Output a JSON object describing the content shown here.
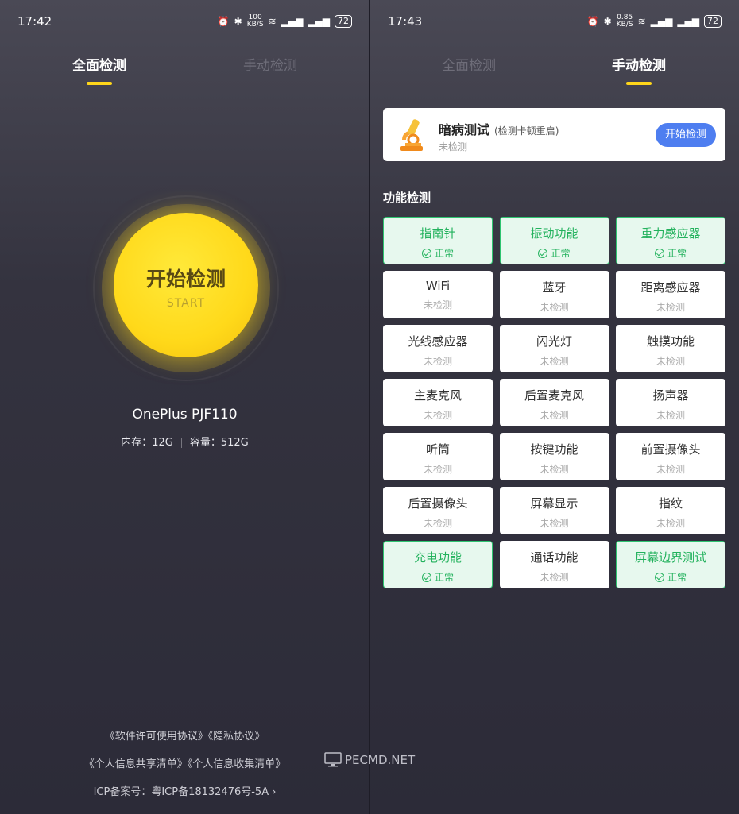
{
  "left": {
    "status": {
      "time": "17:42",
      "speed_top": "100",
      "speed_bottom": "KB/S",
      "battery": "72"
    },
    "tabs": [
      {
        "label": "全面检测",
        "active": true
      },
      {
        "label": "手动检测",
        "active": false
      }
    ],
    "start": {
      "label": "开始检测",
      "sub": "START"
    },
    "device": {
      "model": "OnePlus PJF110",
      "memory": "内存：12G",
      "storage": "容量：512G"
    },
    "footer": {
      "line1": "《软件许可使用协议》《隐私协议》",
      "line2": "《个人信息共享清单》《个人信息收集清单》",
      "icp": "ICP备案号：粤ICP备18132476号-5A",
      "icp_arrow": "›"
    }
  },
  "right": {
    "status": {
      "time": "17:43",
      "speed_top": "0.85",
      "speed_bottom": "KB/S",
      "battery": "72"
    },
    "tabs": [
      {
        "label": "全面检测",
        "active": false
      },
      {
        "label": "手动检测",
        "active": true
      }
    ],
    "card": {
      "title": "暗病测试",
      "subtitle": "(检测卡顿重启)",
      "state": "未检测",
      "button": "开始检测"
    },
    "section_title": "功能检测",
    "items": [
      {
        "name": "指南针",
        "status": "正常",
        "ok": true
      },
      {
        "name": "振动功能",
        "status": "正常",
        "ok": true
      },
      {
        "name": "重力感应器",
        "status": "正常",
        "ok": true
      },
      {
        "name": "WiFi",
        "status": "未检测",
        "ok": false
      },
      {
        "name": "蓝牙",
        "status": "未检测",
        "ok": false
      },
      {
        "name": "距离感应器",
        "status": "未检测",
        "ok": false
      },
      {
        "name": "光线感应器",
        "status": "未检测",
        "ok": false
      },
      {
        "name": "闪光灯",
        "status": "未检测",
        "ok": false
      },
      {
        "name": "触摸功能",
        "status": "未检测",
        "ok": false
      },
      {
        "name": "主麦克风",
        "status": "未检测",
        "ok": false
      },
      {
        "name": "后置麦克风",
        "status": "未检测",
        "ok": false
      },
      {
        "name": "扬声器",
        "status": "未检测",
        "ok": false
      },
      {
        "name": "听筒",
        "status": "未检测",
        "ok": false
      },
      {
        "name": "按键功能",
        "status": "未检测",
        "ok": false
      },
      {
        "name": "前置摄像头",
        "status": "未检测",
        "ok": false
      },
      {
        "name": "后置摄像头",
        "status": "未检测",
        "ok": false
      },
      {
        "name": "屏幕显示",
        "status": "未检测",
        "ok": false
      },
      {
        "name": "指纹",
        "status": "未检测",
        "ok": false
      },
      {
        "name": "充电功能",
        "status": "正常",
        "ok": true
      },
      {
        "name": "通话功能",
        "status": "未检测",
        "ok": false
      },
      {
        "name": "屏幕边界测试",
        "status": "正常",
        "ok": true
      }
    ]
  },
  "watermark": "PECMD.NET",
  "colors": {
    "accent_yellow": "#ffd61a",
    "ok_green": "#23b25d",
    "button_blue": "#4e7ef0"
  },
  "icons": [
    "alarm-icon",
    "bluetooth-icon",
    "wifi-icon",
    "signal-icon",
    "battery-icon",
    "microscope-icon",
    "check-circle-icon",
    "monitor-icon"
  ]
}
